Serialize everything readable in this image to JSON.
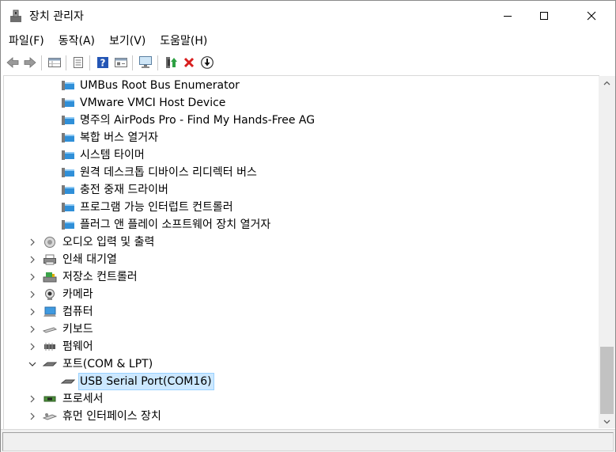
{
  "window": {
    "title": "장치 관리자",
    "icon": "device-manager-icon"
  },
  "caption_buttons": [
    "minimize-icon",
    "maximize-icon",
    "close-icon"
  ],
  "menu": [
    {
      "label": "파일(F)"
    },
    {
      "label": "동작(A)"
    },
    {
      "label": "보기(V)"
    },
    {
      "label": "도움말(H)"
    }
  ],
  "toolbar": [
    "back-arrow-icon",
    "forward-arrow-icon",
    "properties-grid-icon",
    "device-list-icon",
    "help-icon",
    "view-resources-icon",
    "scan-monitor-icon",
    "update-driver-icon",
    "uninstall-x-icon",
    "download-driver-icon"
  ],
  "tree": {
    "system_devices_children": [
      "UMBus Root Bus Enumerator",
      "VMware VMCI Host Device",
      "명주의 AirPods Pro - Find My Hands-Free AG",
      "복합 버스 열거자",
      "시스템 타이머",
      "원격 데스크톱 디바이스 리디렉터 버스",
      "충전 중재 드라이버",
      "프로그램 가능 인터럽트 컨트롤러",
      "플러그 앤 플레이 소프트웨어 장치 열거자"
    ],
    "categories_before": [
      {
        "label": "오디오 입력 및 출력",
        "icon": "audio-speaker-icon"
      },
      {
        "label": "인쇄 대기열",
        "icon": "printer-icon"
      },
      {
        "label": "저장소 컨트롤러",
        "icon": "storage-controller-icon"
      },
      {
        "label": "카메라",
        "icon": "webcam-icon"
      },
      {
        "label": "컴퓨터",
        "icon": "computer-icon"
      },
      {
        "label": "키보드",
        "icon": "keyboard-icon"
      },
      {
        "label": "펌웨어",
        "icon": "firmware-chip-icon"
      }
    ],
    "ports": {
      "label": "포트(COM & LPT)",
      "icon": "port-connector-icon",
      "child": "USB Serial Port(COM16)"
    },
    "categories_after": [
      {
        "label": "프로세서",
        "icon": "processor-icon"
      },
      {
        "label": "휴먼 인터페이스 장치",
        "icon": "hid-icon"
      }
    ]
  },
  "colors": {
    "selection_bg": "#cce8ff",
    "selection_border": "#99d1ff",
    "scrollbar_thumb": "#c2c2c2"
  }
}
